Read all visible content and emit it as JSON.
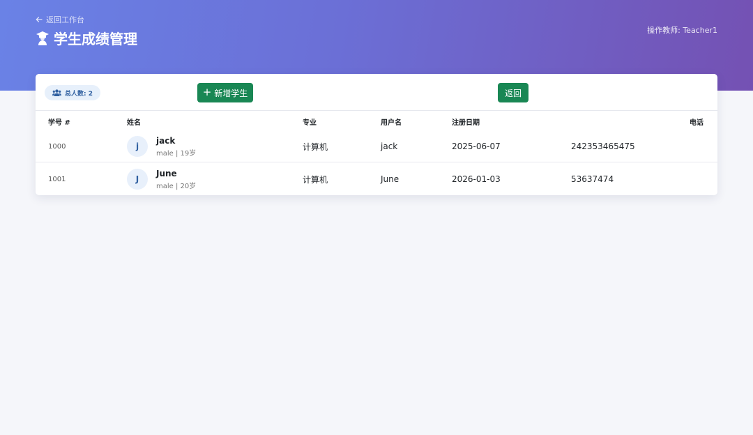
{
  "header": {
    "back_label": "返回工作台",
    "title": "学生成绩管理",
    "teacher": "操作教师: Teacher1"
  },
  "toolbar": {
    "count_badge": "总人数: 2",
    "add_label": "新增学生",
    "add_plus": "+",
    "back_label": "返回"
  },
  "table": {
    "columns": [
      "学号 #",
      "姓名",
      "专业",
      "用户名",
      "注册日期",
      "电话"
    ],
    "rows": [
      {
        "id": "1000",
        "initial": "j",
        "name": "jack",
        "meta": "male | 19岁",
        "major": "计算机",
        "username": "jack",
        "date": "2025-06-07",
        "phone": "242353465475"
      },
      {
        "id": "1001",
        "initial": "J",
        "name": "June",
        "meta": "male | 20岁",
        "major": "计算机",
        "username": "June",
        "date": "2026-01-03",
        "phone": "53637474"
      }
    ]
  },
  "colors": {
    "header_gradient_start": "#6a82e6",
    "header_gradient_end": "#7451b3",
    "primary_button": "#198754",
    "badge_bg": "#e7f0fb"
  },
  "icons": {
    "back": "arrow-left-icon",
    "title": "graduation-icon",
    "badge": "users-icon",
    "add": "plus-icon"
  }
}
